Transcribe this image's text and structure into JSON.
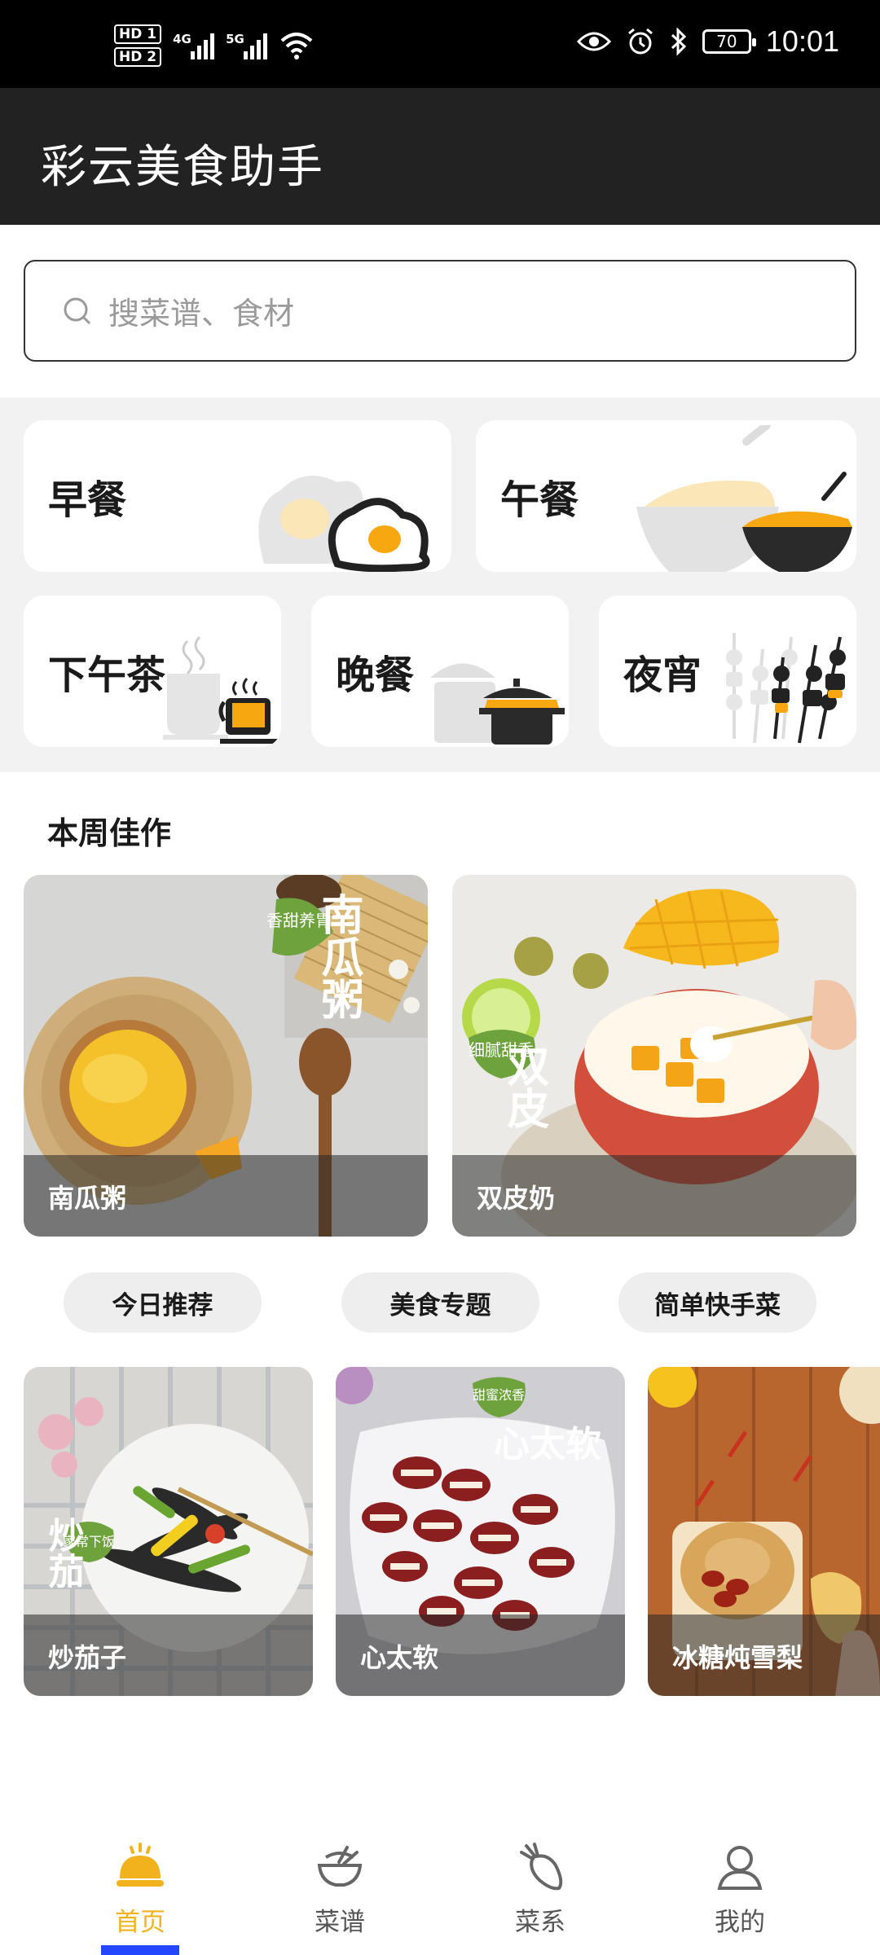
{
  "status_bar": {
    "sim1": "HD 1",
    "sim2": "HD 2",
    "net1": "4G",
    "net2": "5G",
    "battery": "70",
    "time": "10:01"
  },
  "app": {
    "title": "彩云美食助手"
  },
  "search": {
    "placeholder": "搜菜谱、食材"
  },
  "categories": [
    {
      "label": "早餐"
    },
    {
      "label": "午餐"
    },
    {
      "label": "下午茶"
    },
    {
      "label": "晚餐"
    },
    {
      "label": "夜宵"
    }
  ],
  "weekly": {
    "title": "本周佳作",
    "items": [
      {
        "name": "南瓜粥",
        "overlay": "南瓜粥",
        "badge": "香甜养胃"
      },
      {
        "name": "双皮奶",
        "overlay": "双皮",
        "badge": "细腻甜香"
      }
    ]
  },
  "tabs": [
    {
      "label": "今日推荐"
    },
    {
      "label": "美食专题"
    },
    {
      "label": "简单快手菜"
    }
  ],
  "recommend": {
    "items": [
      {
        "name": "炒茄子",
        "overlay": "炒茄",
        "badge": "家常下饭"
      },
      {
        "name": "心太软",
        "overlay": "心太软",
        "badge": "甜蜜浓香"
      },
      {
        "name": "冰糖炖雪梨"
      }
    ]
  },
  "nav": [
    {
      "label": "首页",
      "icon": "home-cloche-icon"
    },
    {
      "label": "菜谱",
      "icon": "bowl-icon"
    },
    {
      "label": "菜系",
      "icon": "radish-icon"
    },
    {
      "label": "我的",
      "icon": "user-icon"
    }
  ],
  "colors": {
    "accent": "#f2b21b",
    "titlebar": "#222222",
    "indicator": "#2346ff",
    "egg_yolk": "#f7a70f"
  }
}
